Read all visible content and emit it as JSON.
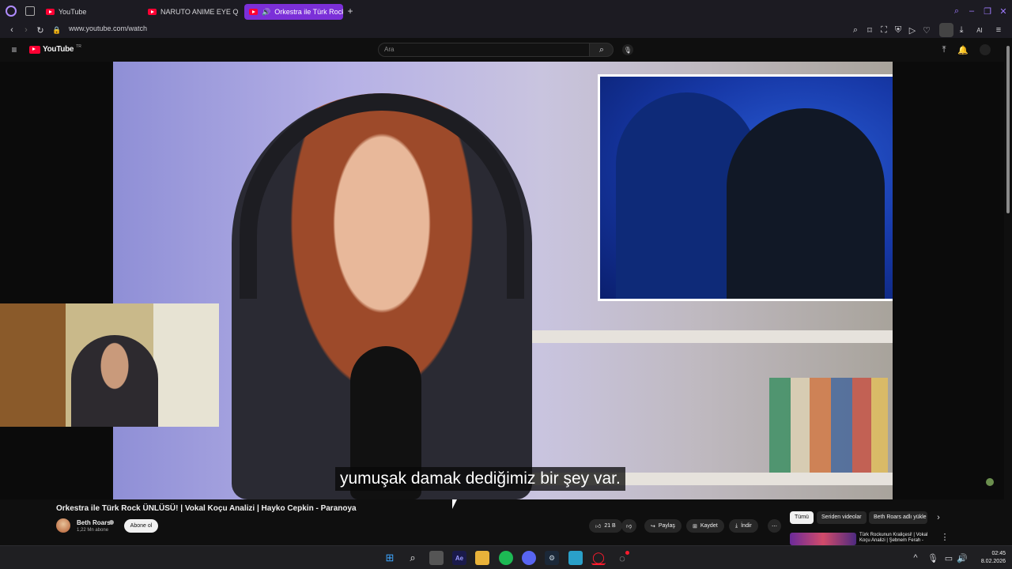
{
  "browser": {
    "tabs": [
      {
        "label": "YouTube",
        "active": false
      },
      {
        "label": "NARUTO ANIME EYE QUIZ",
        "active": false
      },
      {
        "label": "Orkestra ile Türk Rock",
        "active": true
      }
    ],
    "new_tab": "+",
    "url": "www.youtube.com/watch",
    "ai_label": "AI"
  },
  "youtube": {
    "logo_text": "YouTube",
    "region": "TR",
    "search_placeholder": "Ara",
    "caption": "yumuşak damak dediğimiz bir şey var.",
    "video": {
      "title": "Orkestra ile Türk Rock ÜNLÜSÜ! | Vokal Koçu Analizi | Hayko Cepkin - Paranoya",
      "channel": "Beth Roars",
      "subscribers": "1,22 Mn abone",
      "subscribe_label": "Abone ol",
      "likes": "21 B",
      "share_label": "Paylaş",
      "save_label": "Kaydet",
      "download_label": "İndir"
    },
    "chips": [
      "Tümü",
      "Seriden videolar",
      "Beth Roars adlı yükle"
    ],
    "recommended": {
      "title": "Türk Rockunun Kraliçesi! | Vokal Koçu Analizi | Şebnem Ferah -"
    }
  },
  "taskbar": {
    "time": "02:45",
    "date": "8.02.2026"
  },
  "colors": {
    "accent_tab": "#7b2fd8",
    "youtube_red": "#ff0033",
    "background": "#0f0f0f"
  }
}
